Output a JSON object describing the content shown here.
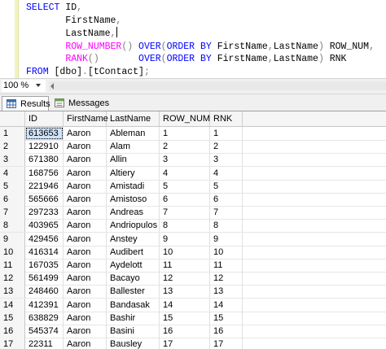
{
  "editor": {
    "lines": [
      [
        {
          "t": "SELECT ",
          "c": "kw"
        },
        {
          "t": "ID",
          "c": "pl"
        },
        {
          "t": ",",
          "c": "gr"
        }
      ],
      [
        {
          "t": "       FirstName",
          "c": "pl"
        },
        {
          "t": ",",
          "c": "gr"
        }
      ],
      [
        {
          "t": "       LastName",
          "c": "pl"
        },
        {
          "t": ",",
          "c": "gr"
        },
        {
          "t": "",
          "c": "caret"
        }
      ],
      [
        {
          "t": "       ",
          "c": "pl"
        },
        {
          "t": "ROW_NUMBER",
          "c": "fn"
        },
        {
          "t": "() ",
          "c": "gr"
        },
        {
          "t": "OVER",
          "c": "kw"
        },
        {
          "t": "(",
          "c": "gr"
        },
        {
          "t": "ORDER BY ",
          "c": "kw"
        },
        {
          "t": "FirstName",
          "c": "pl"
        },
        {
          "t": ",",
          "c": "gr"
        },
        {
          "t": "LastName",
          "c": "pl"
        },
        {
          "t": ") ",
          "c": "gr"
        },
        {
          "t": "ROW_NUM",
          "c": "pl"
        },
        {
          "t": ",",
          "c": "gr"
        }
      ],
      [
        {
          "t": "       ",
          "c": "pl"
        },
        {
          "t": "RANK",
          "c": "fn"
        },
        {
          "t": "()       ",
          "c": "gr"
        },
        {
          "t": "OVER",
          "c": "kw"
        },
        {
          "t": "(",
          "c": "gr"
        },
        {
          "t": "ORDER BY ",
          "c": "kw"
        },
        {
          "t": "FirstName",
          "c": "pl"
        },
        {
          "t": ",",
          "c": "gr"
        },
        {
          "t": "LastName",
          "c": "pl"
        },
        {
          "t": ") ",
          "c": "gr"
        },
        {
          "t": "RNK",
          "c": "pl"
        }
      ],
      [
        {
          "t": "FROM ",
          "c": "kw"
        },
        {
          "t": "[dbo]",
          "c": "pl"
        },
        {
          "t": ".",
          "c": "gr"
        },
        {
          "t": "[tContact]",
          "c": "pl"
        },
        {
          "t": ";",
          "c": "gr"
        }
      ]
    ]
  },
  "zoom": {
    "value": "100 %"
  },
  "tabs": [
    {
      "label": "Results",
      "icon": "grid-icon"
    },
    {
      "label": "Messages",
      "icon": "messages-icon"
    }
  ],
  "grid": {
    "columns": [
      "",
      "ID",
      "FirstName",
      "LastName",
      "ROW_NUM",
      "RNK"
    ],
    "rows": [
      [
        "1",
        "613653",
        "Aaron",
        "Ableman",
        "1",
        "1"
      ],
      [
        "2",
        "122910",
        "Aaron",
        "Alam",
        "2",
        "2"
      ],
      [
        "3",
        "671380",
        "Aaron",
        "Allin",
        "3",
        "3"
      ],
      [
        "4",
        "168756",
        "Aaron",
        "Altiery",
        "4",
        "4"
      ],
      [
        "5",
        "221946",
        "Aaron",
        "Amistadi",
        "5",
        "5"
      ],
      [
        "6",
        "565666",
        "Aaron",
        "Amistoso",
        "6",
        "6"
      ],
      [
        "7",
        "297233",
        "Aaron",
        "Andreas",
        "7",
        "7"
      ],
      [
        "8",
        "403965",
        "Aaron",
        "Andriopulos",
        "8",
        "8"
      ],
      [
        "9",
        "429456",
        "Aaron",
        "Anstey",
        "9",
        "9"
      ],
      [
        "10",
        "416314",
        "Aaron",
        "Audibert",
        "10",
        "10"
      ],
      [
        "11",
        "167035",
        "Aaron",
        "Aydelott",
        "11",
        "11"
      ],
      [
        "12",
        "561499",
        "Aaron",
        "Bacayo",
        "12",
        "12"
      ],
      [
        "13",
        "248460",
        "Aaron",
        "Ballester",
        "13",
        "13"
      ],
      [
        "14",
        "412391",
        "Aaron",
        "Bandasak",
        "14",
        "14"
      ],
      [
        "15",
        "638829",
        "Aaron",
        "Bashir",
        "15",
        "15"
      ],
      [
        "16",
        "545374",
        "Aaron",
        "Basini",
        "16",
        "16"
      ],
      [
        "17",
        "22311",
        "Aaron",
        "Bausley",
        "17",
        "17"
      ]
    ]
  }
}
